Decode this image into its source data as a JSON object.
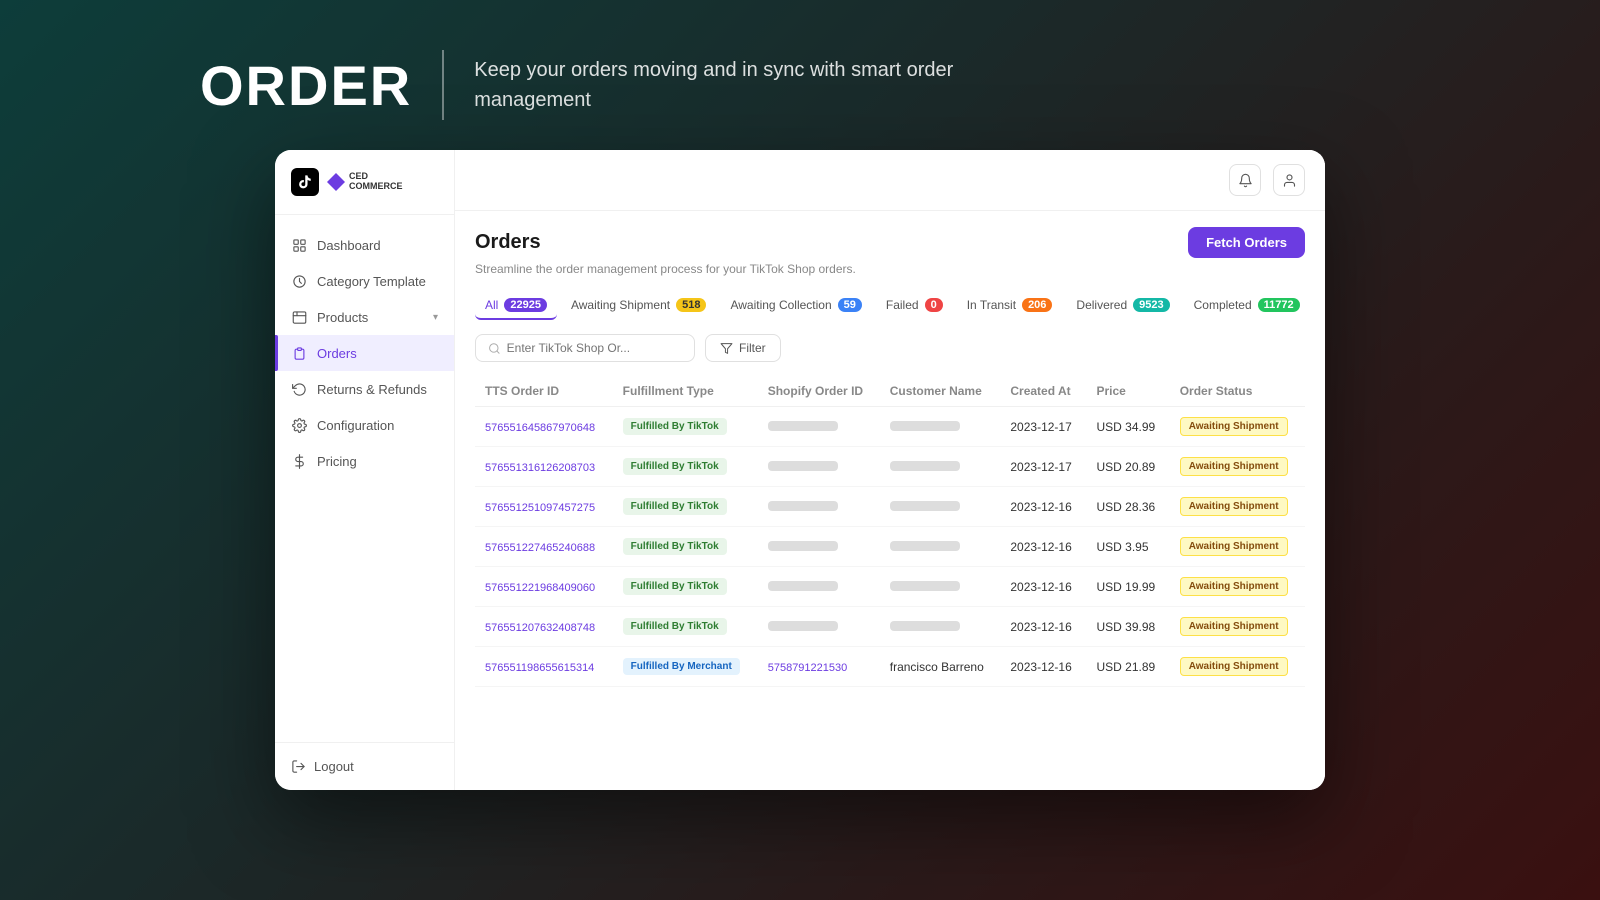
{
  "header": {
    "title": "ORDER",
    "subtitle": "Keep your orders moving and in sync with smart order management"
  },
  "sidebar": {
    "logo_tiktok": "♪",
    "logo_ced_line1": "CED",
    "logo_ced_line2": "COMMERCE",
    "nav_items": [
      {
        "id": "dashboard",
        "label": "Dashboard",
        "active": false
      },
      {
        "id": "category-template",
        "label": "Category Template",
        "active": false
      },
      {
        "id": "products",
        "label": "Products",
        "active": false,
        "has_expand": true
      },
      {
        "id": "orders",
        "label": "Orders",
        "active": true
      },
      {
        "id": "returns-refunds",
        "label": "Returns & Refunds",
        "active": false
      },
      {
        "id": "configuration",
        "label": "Configuration",
        "active": false
      },
      {
        "id": "pricing",
        "label": "Pricing",
        "active": false
      }
    ],
    "logout_label": "Logout"
  },
  "topbar": {
    "bell_icon": "bell",
    "user_icon": "user"
  },
  "orders_page": {
    "title": "Orders",
    "subtitle": "Streamline the order management process for your TikTok Shop orders.",
    "fetch_orders_label": "Fetch Orders",
    "tabs": [
      {
        "id": "all",
        "label": "All",
        "count": "22925",
        "badge_class": "badge-purple",
        "active": true
      },
      {
        "id": "awaiting-shipment",
        "label": "Awaiting Shipment",
        "count": "518",
        "badge_class": "badge-yellow",
        "active": false
      },
      {
        "id": "awaiting-collection",
        "label": "Awaiting Collection",
        "count": "59",
        "badge_class": "badge-blue",
        "active": false
      },
      {
        "id": "failed",
        "label": "Failed",
        "count": "0",
        "badge_class": "badge-red",
        "active": false
      },
      {
        "id": "in-transit",
        "label": "In Transit",
        "count": "206",
        "badge_class": "badge-orange",
        "active": false
      },
      {
        "id": "delivered",
        "label": "Delivered",
        "count": "9523",
        "badge_class": "badge-teal",
        "active": false
      },
      {
        "id": "completed",
        "label": "Completed",
        "count": "11772",
        "badge_class": "badge-green",
        "active": false
      }
    ],
    "search_placeholder": "Enter TikTok Shop Or...",
    "filter_label": "Filter",
    "table_headers": [
      "TTS Order ID",
      "Fulfillment Type",
      "Shopify Order ID",
      "Customer Name",
      "Created At",
      "Price",
      "Order Status"
    ],
    "orders": [
      {
        "id": "576551645867970648",
        "fulfillment_type": "Fulfilled By TikTok",
        "fulfillment_class": "tiktok",
        "shopify_id": "",
        "shopify_visible": false,
        "customer_name": "",
        "customer_blur": true,
        "created_at": "2023-12-17",
        "price": "USD 34.99",
        "status": "Awaiting Shipment"
      },
      {
        "id": "576551316126208703",
        "fulfillment_type": "Fulfilled By TikTok",
        "fulfillment_class": "tiktok",
        "shopify_id": "",
        "shopify_visible": false,
        "customer_name": "",
        "customer_blur": true,
        "created_at": "2023-12-17",
        "price": "USD 20.89",
        "status": "Awaiting Shipment"
      },
      {
        "id": "576551251097457275",
        "fulfillment_type": "Fulfilled By TikTok",
        "fulfillment_class": "tiktok",
        "shopify_id": "",
        "shopify_visible": false,
        "customer_name": "",
        "customer_blur": true,
        "created_at": "2023-12-16",
        "price": "USD 28.36",
        "status": "Awaiting Shipment"
      },
      {
        "id": "576551227465240688",
        "fulfillment_type": "Fulfilled By TikTok",
        "fulfillment_class": "tiktok",
        "shopify_id": "",
        "shopify_visible": false,
        "customer_name": "",
        "customer_blur": true,
        "created_at": "2023-12-16",
        "price": "USD 3.95",
        "status": "Awaiting Shipment"
      },
      {
        "id": "576551221968409060",
        "fulfillment_type": "Fulfilled By TikTok",
        "fulfillment_class": "tiktok",
        "shopify_id": "",
        "shopify_visible": false,
        "customer_name": "",
        "customer_blur": true,
        "created_at": "2023-12-16",
        "price": "USD 19.99",
        "status": "Awaiting Shipment"
      },
      {
        "id": "576551207632408748",
        "fulfillment_type": "Fulfilled By TikTok",
        "fulfillment_class": "tiktok",
        "shopify_id": "",
        "shopify_visible": false,
        "customer_name": "",
        "customer_blur": true,
        "created_at": "2023-12-16",
        "price": "USD 39.98",
        "status": "Awaiting Shipment"
      },
      {
        "id": "576551198655615314",
        "fulfillment_type": "Fulfilled By Merchant",
        "fulfillment_class": "merchant",
        "shopify_id": "5758791221530",
        "shopify_visible": true,
        "customer_name": "francisco Barreno",
        "customer_blur": false,
        "created_at": "2023-12-16",
        "price": "USD 21.89",
        "status": "Awaiting Shipment"
      }
    ]
  }
}
